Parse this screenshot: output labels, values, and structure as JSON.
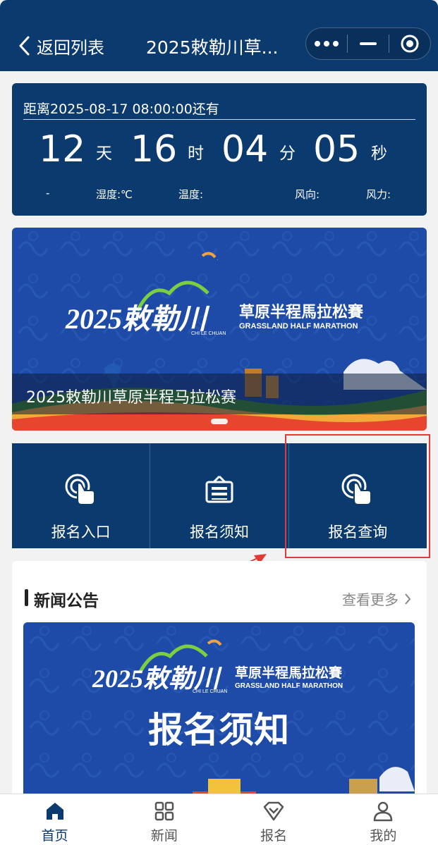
{
  "header": {
    "back_label": "返回列表",
    "title": "2025敕勒川草...",
    "menu_icons": [
      "more-dots-icon",
      "minimize-icon",
      "close-circle-icon"
    ]
  },
  "countdown": {
    "target_label": "距离2025-08-17 08:00:00还有",
    "days": "12",
    "days_unit": "天",
    "hours": "16",
    "hours_unit": "时",
    "minutes": "04",
    "minutes_unit": "分",
    "seconds": "05",
    "seconds_unit": "秒",
    "weather": {
      "condition": "-",
      "humidity_label": "湿度:℃",
      "temperature_label": "温度:",
      "wind_direction_label": "风向:",
      "wind_power_label": "风力:"
    }
  },
  "banner": {
    "logo_title": "2025敕勒川",
    "logo_subtitle_cn": "草原半程馬拉松賽",
    "logo_subtitle_en": "GRASSLAND HALF MARATHON",
    "logo_pinyin": "CHI LE CHUAN",
    "caption": "2025敕勒川草原半程马拉松赛"
  },
  "actions": [
    {
      "label": "报名入口",
      "icon": "tap-finger-icon"
    },
    {
      "label": "报名须知",
      "icon": "notice-board-icon"
    },
    {
      "label": "报名查询",
      "icon": "tap-finger-icon"
    }
  ],
  "news": {
    "section_title": "新闻公告",
    "more_label": "查看更多",
    "item_image_title": "2025敕勒川",
    "item_image_subtitle_cn": "草原半程馬拉松賽",
    "item_image_subtitle_en": "GRASSLAND HALF MARATHON",
    "item_image_pinyin": "CHI LE CHUAN",
    "item_image_headline": "报名须知"
  },
  "tabbar": [
    {
      "label": "首页",
      "icon": "home-icon",
      "active": true
    },
    {
      "label": "新闻",
      "icon": "grid-icon",
      "active": false
    },
    {
      "label": "报名",
      "icon": "diamond-icon",
      "active": false
    },
    {
      "label": "我的",
      "icon": "user-icon",
      "active": false
    }
  ],
  "colors": {
    "primary": "#0b3a6f",
    "highlight": "#e53935",
    "page_bg": "#f2f2f2"
  }
}
